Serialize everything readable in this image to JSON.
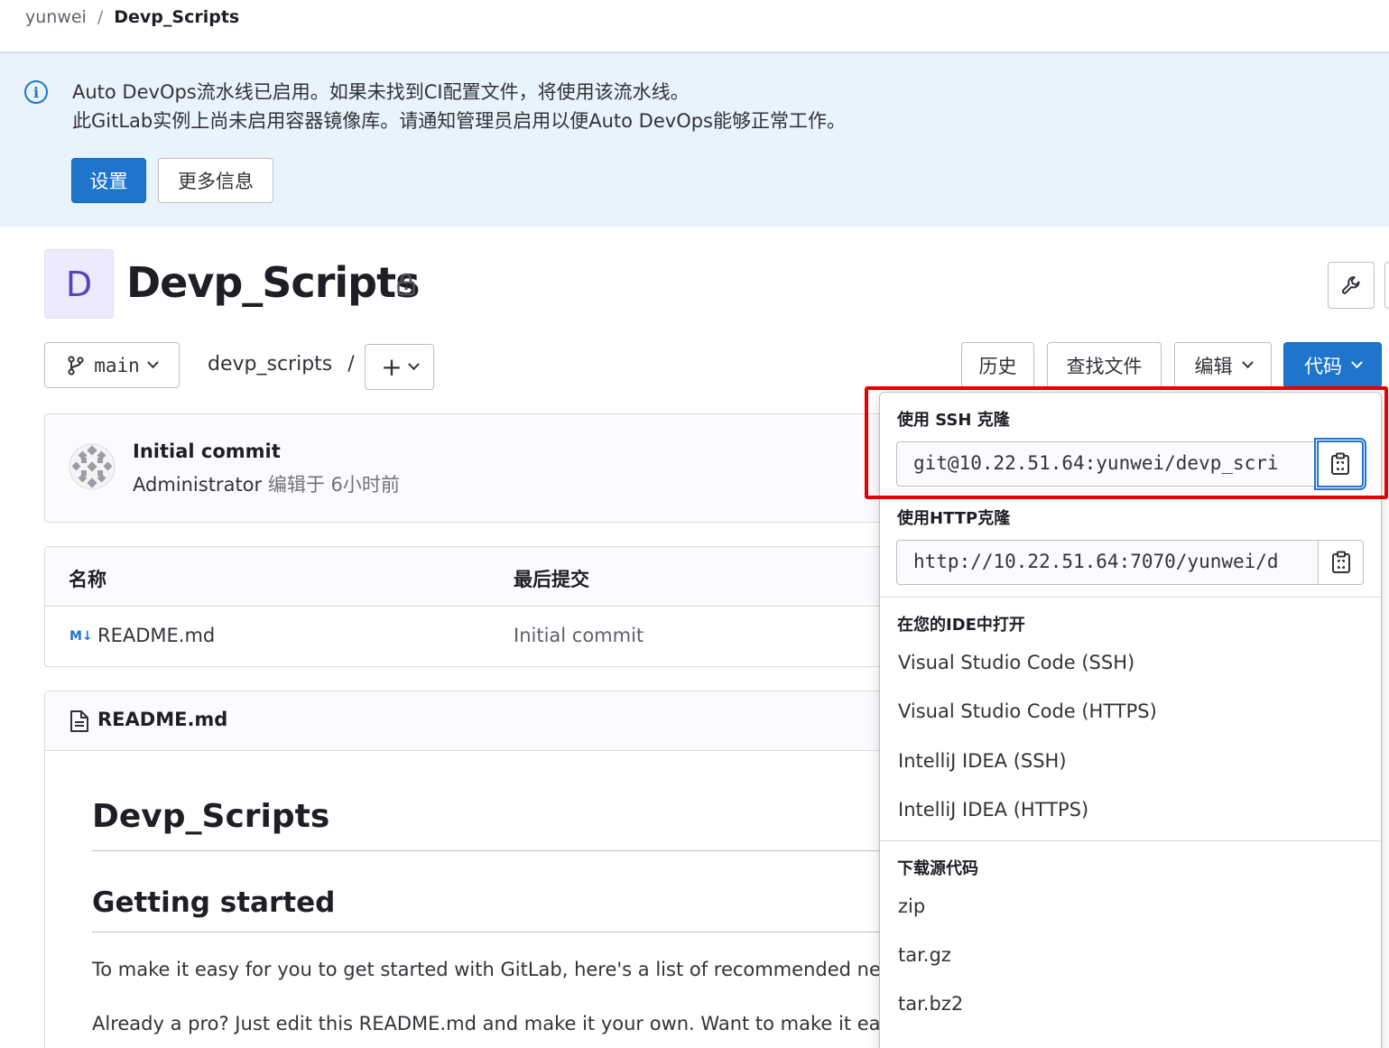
{
  "breadcrumb": {
    "user": "yunwei",
    "separator": "/",
    "project": "Devp_Scripts"
  },
  "alert": {
    "line1": "Auto DevOps流水线已启用。如果未找到CI配置文件，将使用该流水线。",
    "line2": "此GitLab实例上尚未启用容器镜像库。请通知管理员启用以便Auto DevOps能够正常工作。",
    "primary_button": "设置",
    "secondary_button": "更多信息",
    "icon": "info-icon"
  },
  "project": {
    "avatar_letter": "D",
    "title": "Devp_Scripts",
    "visibility_icon": "lock-icon"
  },
  "toolbar": {
    "branch": "main",
    "path": "devp_scripts",
    "path_sep": "/",
    "history": "历史",
    "find_file": "查找文件",
    "edit": "编辑",
    "code": "代码"
  },
  "commit": {
    "title": "Initial commit",
    "author": "Administrator",
    "meta": "编辑于 6小时前"
  },
  "files": {
    "headers": [
      "名称",
      "最后提交"
    ],
    "rows": [
      {
        "icon": "M↓",
        "name": "README.md",
        "last_commit": "Initial commit"
      }
    ]
  },
  "readme": {
    "filename": "README.md",
    "h1": "Devp_Scripts",
    "h2": "Getting started",
    "para1": "To make it easy for you to get started with GitLab, here's a list of recommended ne",
    "para2": "Already a pro? Just edit this README.md and make it your own. Want to make it ea"
  },
  "clone_dropdown": {
    "ssh_label": "使用 SSH 克隆",
    "ssh_url": "git@10.22.51.64:yunwei/devp_scri",
    "http_label": "使用HTTP克隆",
    "http_url": "http://10.22.51.64:7070/yunwei/d",
    "ide_label": "在您的IDE中打开",
    "ide_items": [
      "Visual Studio Code (SSH)",
      "Visual Studio Code (HTTPS)",
      "IntelliJ IDEA (SSH)",
      "IntelliJ IDEA (HTTPS)"
    ],
    "download_label": "下载源代码",
    "download_items": [
      "zip",
      "tar.gz",
      "tar.bz2"
    ]
  },
  "colors": {
    "primary": "#1f75cb",
    "alert_bg": "#e9f3fc",
    "highlight": "#e60000"
  }
}
